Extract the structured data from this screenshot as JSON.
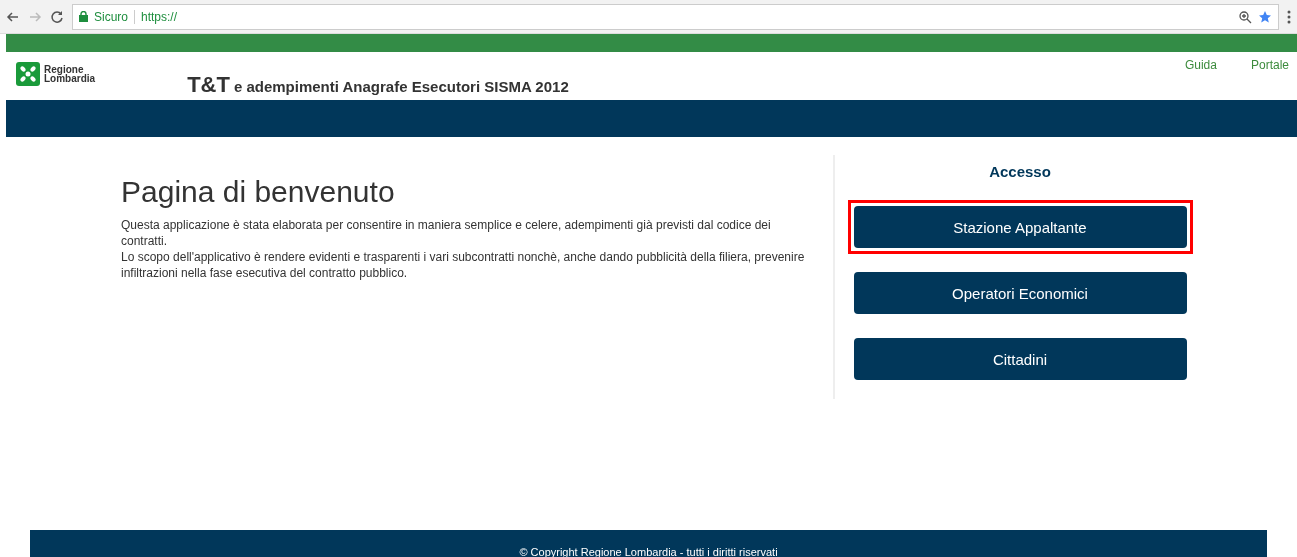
{
  "browser": {
    "security_label": "Sicuro",
    "url": "https://"
  },
  "header": {
    "logo_text": "Regione\nLombardia",
    "title_big": "T&T",
    "title_rest": "e adempimenti Anagrafe Esecutori SISMA 2012",
    "links": [
      "Guida",
      "Portale"
    ]
  },
  "welcome": {
    "heading": "Pagina di benvenuto",
    "paragraphs": [
      "Questa applicazione è stata elaborata per consentire in maniera semplice e celere, adempimenti già previsti dal codice dei contratti.",
      "Lo scopo dell'applicativo è rendere evidenti e trasparenti i vari subcontratti nonchè, anche dando pubblicità della filiera, prevenire infiltrazioni nella fase esecutiva del contratto pubblico."
    ]
  },
  "access": {
    "title": "Accesso",
    "buttons": [
      {
        "label": "Stazione Appaltante",
        "highlighted": true
      },
      {
        "label": "Operatori Economici",
        "highlighted": false
      },
      {
        "label": "Cittadini",
        "highlighted": false
      }
    ]
  },
  "footer": {
    "text": "© Copyright Regione Lombardia - tutti i diritti riservati"
  }
}
